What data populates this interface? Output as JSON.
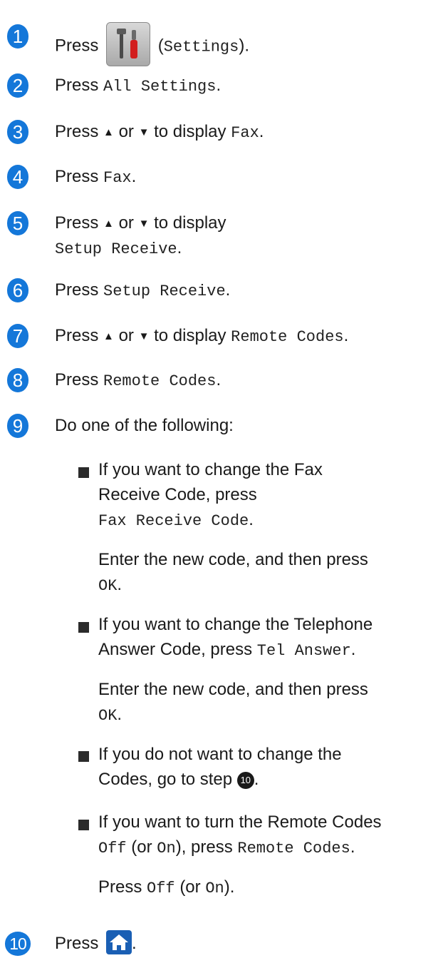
{
  "steps": [
    {
      "num": "1",
      "press": "Press",
      "paren_open": "(",
      "code": "Settings",
      "paren_close": ").",
      "icon": "settings-icon"
    },
    {
      "num": "2",
      "press": "Press",
      "code": "All Settings",
      "end": "."
    },
    {
      "num": "3",
      "press": "Press",
      "up": "▲",
      "or": "or",
      "down": "▼",
      "todisplay": "to display",
      "code": "Fax",
      "end": "."
    },
    {
      "num": "4",
      "press": "Press",
      "code": "Fax",
      "end": "."
    },
    {
      "num": "5",
      "press": "Press",
      "up": "▲",
      "or": "or",
      "down": "▼",
      "todisplay": "to display",
      "code": "Setup Receive",
      "end": "."
    },
    {
      "num": "6",
      "press": "Press",
      "code": "Setup Receive",
      "end": "."
    },
    {
      "num": "7",
      "press": "Press",
      "up": "▲",
      "or": "or",
      "down": "▼",
      "todisplay": "to display",
      "code": "Remote Codes",
      "end": "."
    },
    {
      "num": "8",
      "press": "Press",
      "code": "Remote Codes",
      "end": "."
    },
    {
      "num": "9",
      "text": "Do one of the following:"
    },
    {
      "num": "10",
      "press": "Press",
      "icon": "home-icon",
      "end": "."
    }
  ],
  "bullets": [
    {
      "line1": "If you want to change the Fax",
      "line2": "Receive Code, press",
      "code": "Fax Receive Code",
      "end": ".",
      "sub1": "Enter the new code, and then press",
      "sub_code": "OK",
      "sub_end": "."
    },
    {
      "line1": "If you want to change the Telephone",
      "line2": "Answer Code, press",
      "code": "Tel Answer",
      "end": ".",
      "sub1": "Enter the new code, and then press",
      "sub_code": "OK",
      "sub_end": "."
    },
    {
      "line1": "If you do not want to change the",
      "line2": "Codes, go to step",
      "ref": "10",
      "end": "."
    },
    {
      "line1": "If you want to turn the Remote Codes",
      "off": "Off",
      "or_open": "(or",
      "on": "On",
      "close": "), press",
      "code": "Remote Codes",
      "end": ".",
      "sub_press": "Press",
      "sub_off": "Off",
      "sub_or_open": "(or",
      "sub_on": "On",
      "sub_close": ")."
    }
  ]
}
